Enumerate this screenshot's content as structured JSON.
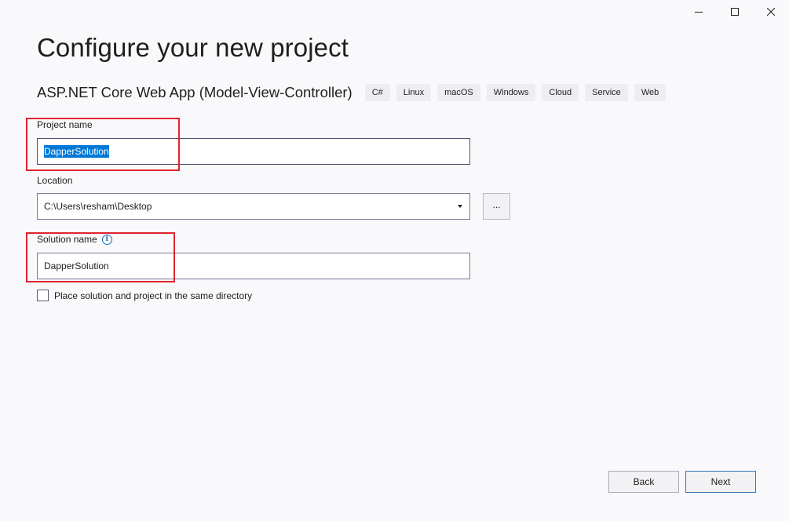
{
  "window": {
    "controls": {
      "minimize": "minimize-icon",
      "maximize": "maximize-icon",
      "close": "close-icon"
    }
  },
  "page": {
    "title": "Configure your new project",
    "template_name": "ASP.NET Core Web App (Model-View-Controller)",
    "tags": [
      "C#",
      "Linux",
      "macOS",
      "Windows",
      "Cloud",
      "Service",
      "Web"
    ]
  },
  "form": {
    "project_name": {
      "label": "Project name",
      "value": "DapperSolution",
      "text_selected": true
    },
    "location": {
      "label": "Location",
      "value": "C:\\Users\\resham\\Desktop",
      "browse_label": "..."
    },
    "solution_name": {
      "label": "Solution name",
      "value": "DapperSolution",
      "info_icon": "info-icon"
    },
    "same_directory": {
      "label": "Place solution and project in the same directory",
      "checked": false
    }
  },
  "footer": {
    "back_label": "Back",
    "next_label": "Next"
  },
  "colors": {
    "background": "#f9f9fb",
    "selection": "#0078d7",
    "annotation_red": "#e0242e",
    "primary_border": "#3373b8"
  }
}
